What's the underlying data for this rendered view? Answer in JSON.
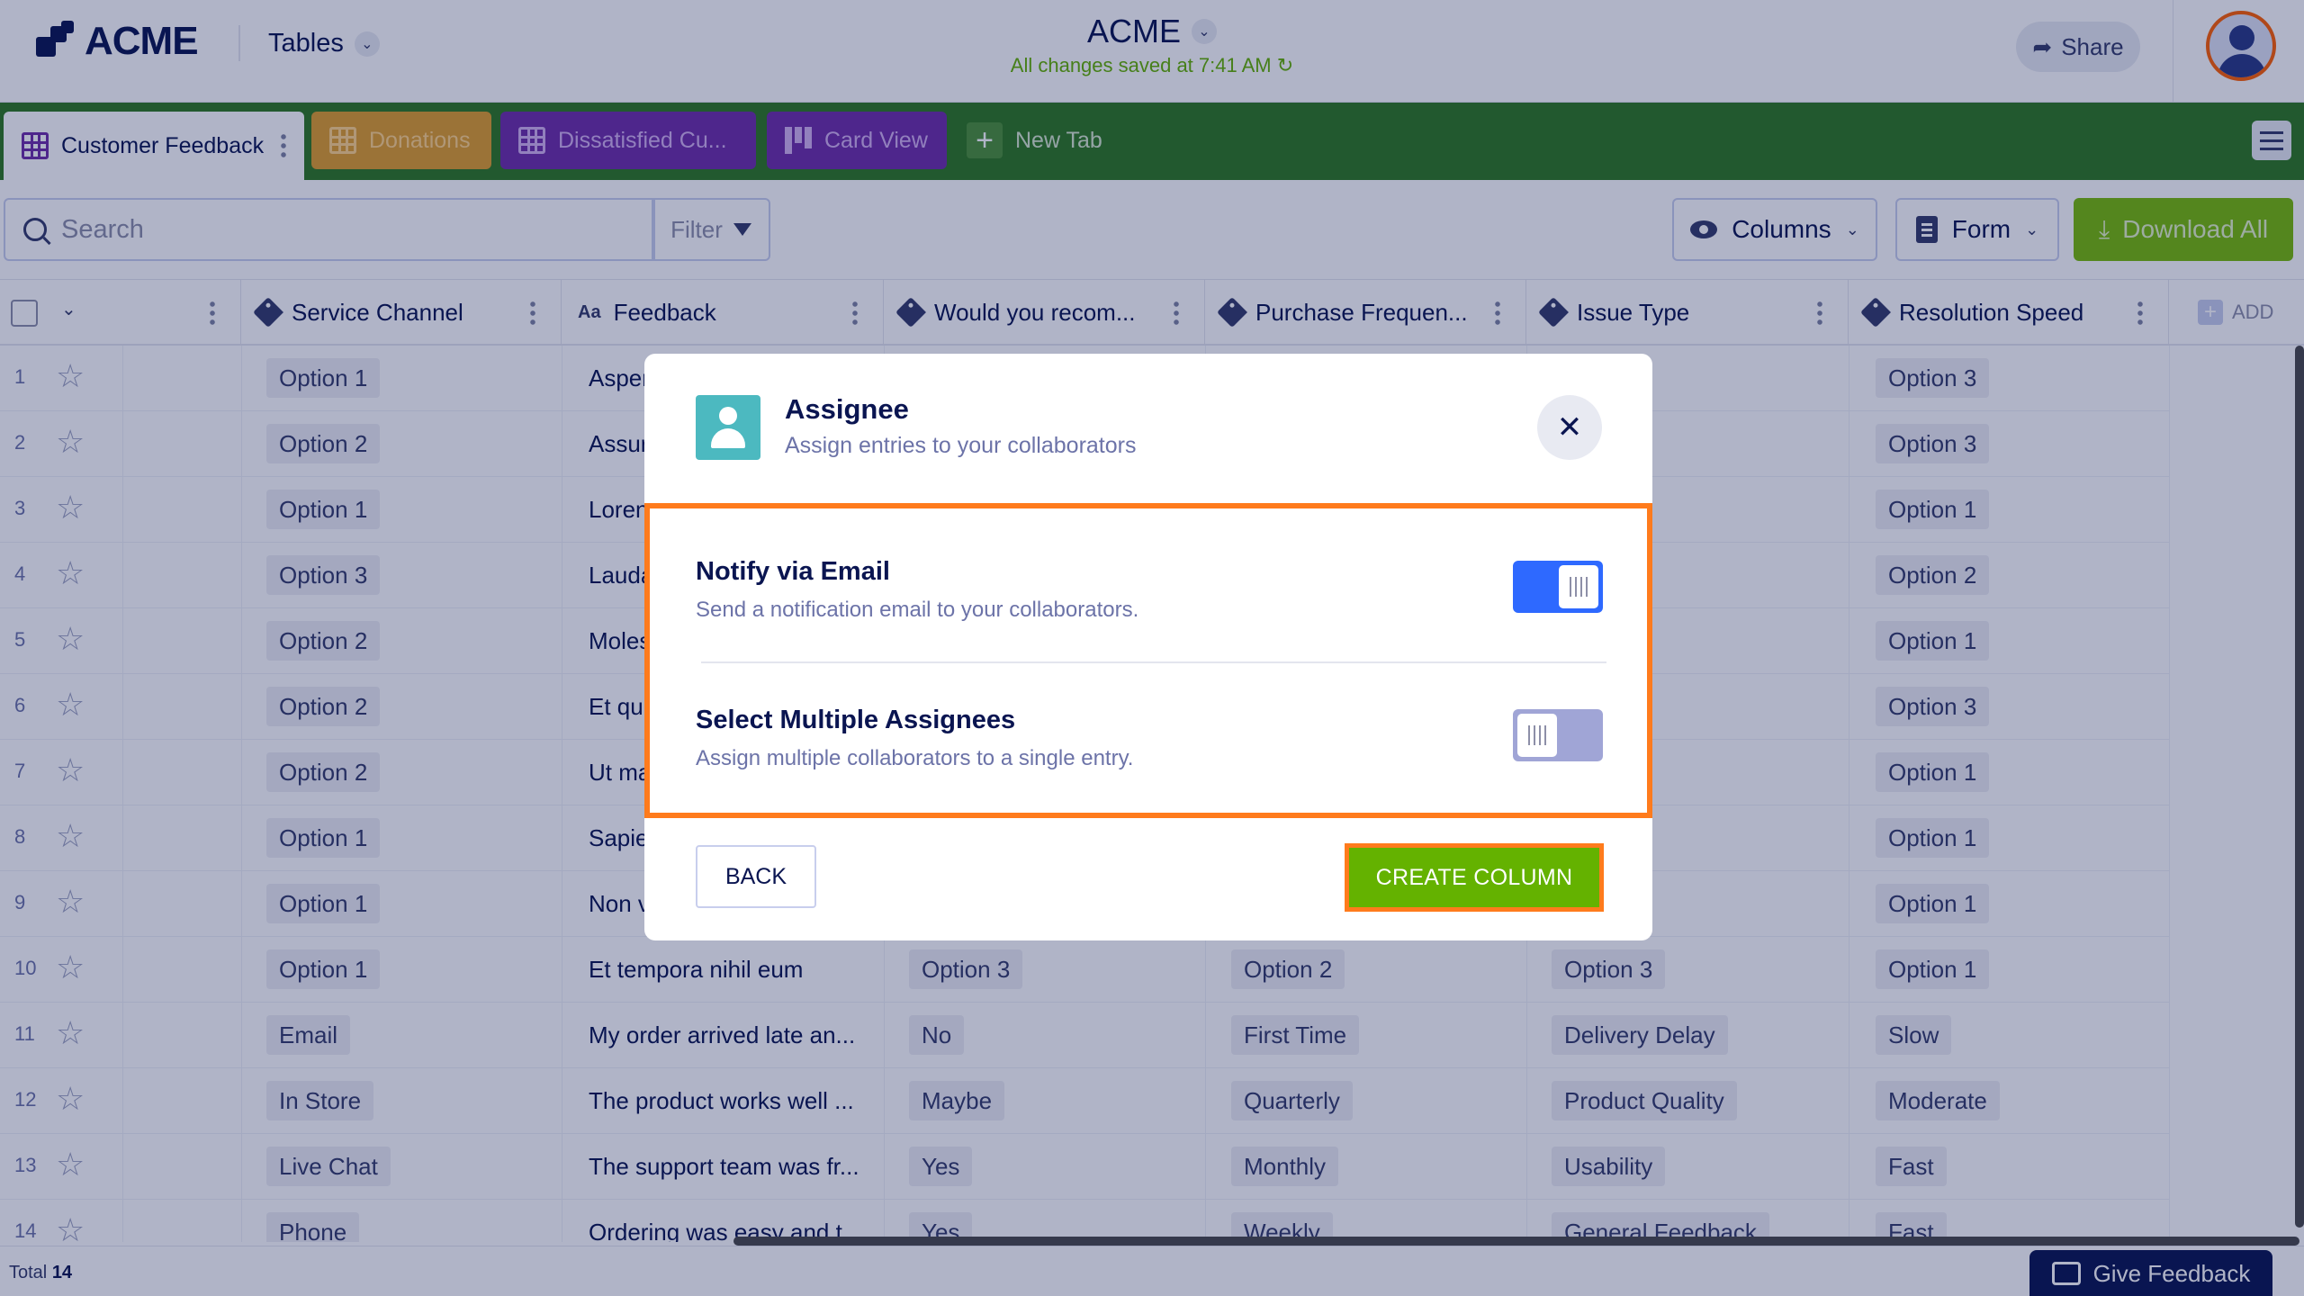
{
  "header": {
    "logo_text": "ACME",
    "tables_label": "Tables",
    "app_title": "ACME",
    "save_status": "All changes saved at 7:41 AM",
    "share_label": "Share"
  },
  "tabs": [
    {
      "label": "Customer Feedback",
      "color": "#ffffff"
    },
    {
      "label": "Donations",
      "color": "#e0a02b"
    },
    {
      "label": "Dissatisfied Cu...",
      "color": "#6f2ea8"
    },
    {
      "label": "Card View",
      "color": "#6f2ea8"
    },
    {
      "label": "New Tab"
    }
  ],
  "toolbar": {
    "search_placeholder": "Search",
    "filter_label": "Filter",
    "columns_label": "Columns",
    "form_label": "Form",
    "download_label": "Download All"
  },
  "table": {
    "columns": [
      "Service Channel",
      "Feedback",
      "Would you recom...",
      "Purchase Frequen...",
      "Issue Type",
      "Resolution Speed"
    ],
    "add_label": "ADD",
    "rows": [
      {
        "n": "1",
        "channel": "Option 1",
        "feedback": "Asper",
        "recommend": "",
        "frequency": "",
        "issue": "",
        "speed": "Option 3"
      },
      {
        "n": "2",
        "channel": "Option 2",
        "feedback": "Assur",
        "recommend": "",
        "frequency": "",
        "issue": "",
        "speed": "Option 3"
      },
      {
        "n": "3",
        "channel": "Option 1",
        "feedback": "Loren",
        "recommend": "",
        "frequency": "",
        "issue": "",
        "speed": "Option 1"
      },
      {
        "n": "4",
        "channel": "Option 3",
        "feedback": "Lauda",
        "recommend": "",
        "frequency": "",
        "issue": "",
        "speed": "Option 2"
      },
      {
        "n": "5",
        "channel": "Option 2",
        "feedback": "Moles",
        "recommend": "",
        "frequency": "",
        "issue": "",
        "speed": "Option 1"
      },
      {
        "n": "6",
        "channel": "Option 2",
        "feedback": "Et qui",
        "recommend": "",
        "frequency": "",
        "issue": "",
        "speed": "Option 3"
      },
      {
        "n": "7",
        "channel": "Option 2",
        "feedback": "Ut ma",
        "recommend": "",
        "frequency": "",
        "issue": "",
        "speed": "Option 1"
      },
      {
        "n": "8",
        "channel": "Option 1",
        "feedback": "Sapie",
        "recommend": "",
        "frequency": "",
        "issue": "",
        "speed": "Option 1"
      },
      {
        "n": "9",
        "channel": "Option 1",
        "feedback": "Non v",
        "recommend": "",
        "frequency": "",
        "issue": "",
        "speed": "Option 1"
      },
      {
        "n": "10",
        "channel": "Option 1",
        "feedback": "Et tempora nihil eum",
        "recommend": "Option 3",
        "frequency": "Option 2",
        "issue": "Option 3",
        "speed": "Option 1"
      },
      {
        "n": "11",
        "channel": "Email",
        "feedback": "My order arrived late an...",
        "recommend": "No",
        "frequency": "First Time",
        "issue": "Delivery Delay",
        "speed": "Slow"
      },
      {
        "n": "12",
        "channel": "In Store",
        "feedback": "The product works well ...",
        "recommend": "Maybe",
        "frequency": "Quarterly",
        "issue": "Product Quality",
        "speed": "Moderate"
      },
      {
        "n": "13",
        "channel": "Live Chat",
        "feedback": "The support team was fr...",
        "recommend": "Yes",
        "frequency": "Monthly",
        "issue": "Usability",
        "speed": "Fast"
      },
      {
        "n": "14",
        "channel": "Phone",
        "feedback": "Ordering was easy and t...",
        "recommend": "Yes",
        "frequency": "Weekly",
        "issue": "General Feedback",
        "speed": "Fast"
      }
    ]
  },
  "footer": {
    "total_label": "Total",
    "total_count": "14",
    "give_feedback_label": "Give Feedback"
  },
  "modal": {
    "title": "Assignee",
    "subtitle": "Assign entries to your collaborators",
    "options": [
      {
        "title": "Notify via Email",
        "description": "Send a notification email to your collaborators.",
        "enabled": true
      },
      {
        "title": "Select Multiple Assignees",
        "description": "Assign multiple collaborators to a single entry.",
        "enabled": false
      }
    ],
    "back_label": "BACK",
    "create_label": "CREATE COLUMN"
  },
  "colors": {
    "tab_bar": "#2f7a1f",
    "toggle_on": "#2e69ff",
    "toggle_off": "#a0a5d6",
    "create_button": "#64b200",
    "highlight": "#ff7b1c"
  }
}
